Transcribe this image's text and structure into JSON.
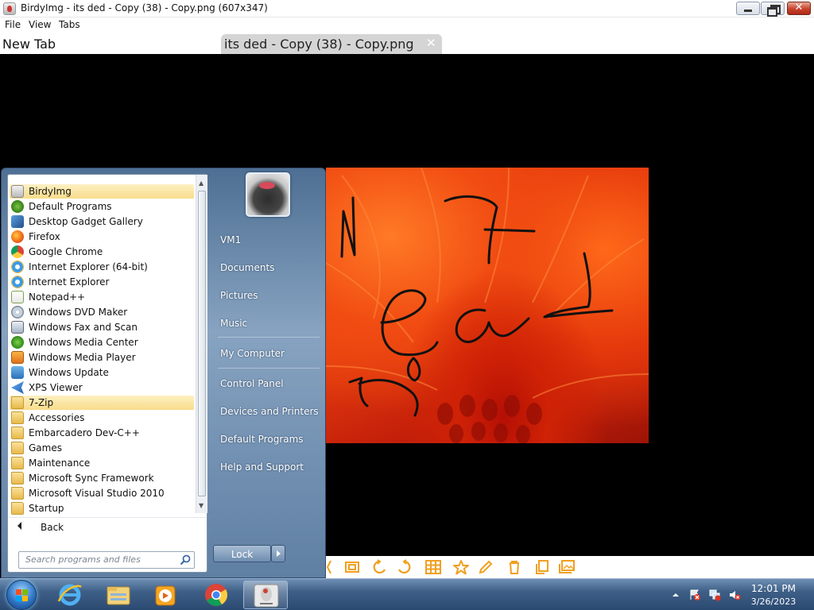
{
  "window": {
    "title": "BirdyImg - its ded - Copy (38) - Copy.png (607x347)",
    "min_icon": "minimize-icon",
    "max_icon": "restore-icon",
    "close_glyph": "✕"
  },
  "menu": {
    "file": "File",
    "view": "View",
    "tabs": "Tabs"
  },
  "tabs": {
    "new_tab": "New Tab",
    "active_label": "its ded - Copy (38) - Copy.png",
    "close_glyph": "✕"
  },
  "image": {
    "description_icon": "flower-drawing-image"
  },
  "toolbar": {
    "icons": [
      "pan-icon",
      "fit-icon",
      "rotate-left-icon",
      "rotate-right-icon",
      "grid-icon",
      "star-icon",
      "edit-icon",
      "delete-icon",
      "copy-icon",
      "gallery-icon"
    ],
    "accent": "#f0a020"
  },
  "start_menu": {
    "programs": [
      {
        "label": "BirdyImg",
        "icon": "birdyimg-icon",
        "highlight": true
      },
      {
        "label": "Default Programs",
        "icon": "default-programs-icon"
      },
      {
        "label": "Desktop Gadget Gallery",
        "icon": "gadget-icon"
      },
      {
        "label": "Firefox",
        "icon": "firefox-icon"
      },
      {
        "label": "Google Chrome",
        "icon": "chrome-icon"
      },
      {
        "label": "Internet Explorer (64-bit)",
        "icon": "ie-icon"
      },
      {
        "label": "Internet Explorer",
        "icon": "ie-icon"
      },
      {
        "label": "Notepad++",
        "icon": "notepad-icon"
      },
      {
        "label": "Windows DVD Maker",
        "icon": "dvd-icon"
      },
      {
        "label": "Windows Fax and Scan",
        "icon": "fax-icon"
      },
      {
        "label": "Windows Media Center",
        "icon": "media-center-icon"
      },
      {
        "label": "Windows Media Player",
        "icon": "media-player-icon"
      },
      {
        "label": "Windows Update",
        "icon": "update-icon"
      },
      {
        "label": "XPS Viewer",
        "icon": "xps-icon"
      },
      {
        "label": "7-Zip",
        "icon": "folder-icon",
        "highlight": true
      },
      {
        "label": "Accessories",
        "icon": "folder-icon"
      },
      {
        "label": "Embarcadero Dev-C++",
        "icon": "folder-icon"
      },
      {
        "label": "Games",
        "icon": "folder-icon"
      },
      {
        "label": "Maintenance",
        "icon": "folder-icon"
      },
      {
        "label": "Microsoft Sync Framework",
        "icon": "folder-icon"
      },
      {
        "label": "Microsoft Visual Studio 2010",
        "icon": "folder-icon"
      },
      {
        "label": "Startup",
        "icon": "folder-icon"
      }
    ],
    "back_label": "Back",
    "search_placeholder": "Search programs and files",
    "right_links": [
      "VM1",
      "Documents",
      "Pictures",
      "Music",
      "My Computer",
      "Control Panel",
      "Devices and Printers",
      "Default Programs",
      "Help and Support"
    ],
    "lock_label": "Lock"
  },
  "taskbar": {
    "items": [
      "start-orb",
      "internet-explorer-icon",
      "windows-explorer-icon",
      "media-player-icon",
      "chrome-icon",
      "birdyimg-icon"
    ],
    "clock_time": "12:01 PM",
    "clock_date": "3/26/2023"
  }
}
